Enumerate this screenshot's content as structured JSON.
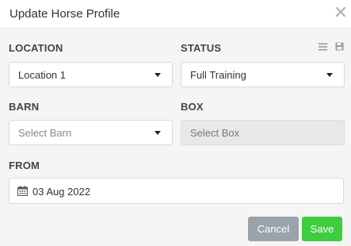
{
  "modal": {
    "title": "Update Horse Profile"
  },
  "form": {
    "location": {
      "label": "LOCATION",
      "value": "Location 1"
    },
    "status": {
      "label": "STATUS",
      "value": "Full Training"
    },
    "barn": {
      "label": "BARN",
      "placeholder": "Select Barn"
    },
    "box": {
      "label": "BOX",
      "placeholder": "Select Box"
    },
    "from": {
      "label": "FROM",
      "value": "03 Aug 2022"
    }
  },
  "icons": {
    "close": "close-icon",
    "list": "list-icon",
    "save": "floppy-disk-icon",
    "calendar": "calendar-icon",
    "caret": "caret-down-icon"
  },
  "actions": {
    "cancel_label": "Cancel",
    "save_label": "Save"
  },
  "colors": {
    "save_button": "#3fcc3f",
    "cancel_button": "#9aa3a9",
    "disabled_field": "#e8e8e8"
  }
}
